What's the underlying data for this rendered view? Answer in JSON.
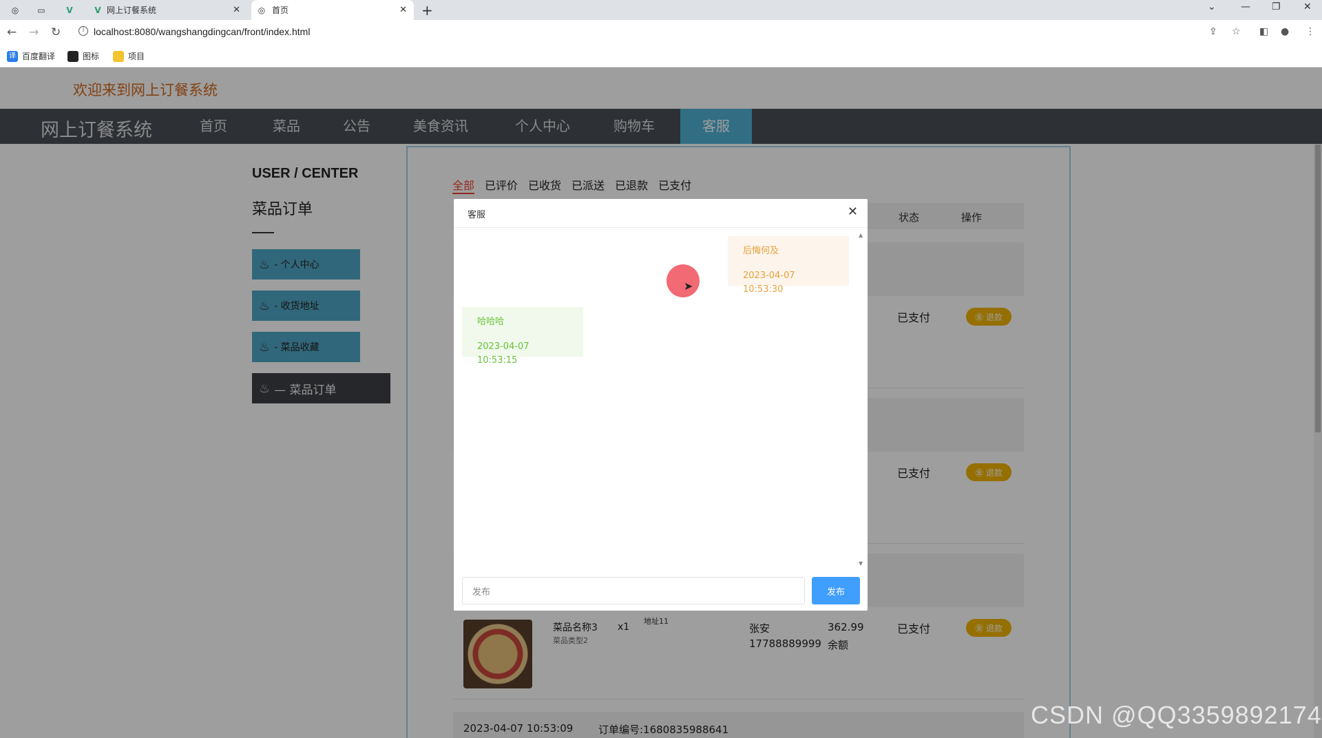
{
  "browser": {
    "tabs": [
      {
        "title": "网上订餐系统"
      },
      {
        "title": "首页"
      }
    ],
    "url": "localhost:8080/wangshangdingcan/front/index.html",
    "bookmarks": [
      "百度翻译",
      "图标",
      "项目"
    ]
  },
  "header": {
    "welcome": "欢迎来到网上订餐系统",
    "logo": "网上订餐系统",
    "nav": [
      "首页",
      "菜品",
      "公告",
      "美食资讯",
      "个人中心",
      "购物车",
      "客服"
    ],
    "active_nav": "客服"
  },
  "sidebar": {
    "heading": "USER / CENTER",
    "title": "菜品订单",
    "items": [
      {
        "label": "- 个人中心"
      },
      {
        "label": "- 收货地址"
      },
      {
        "label": "- 菜品收藏"
      },
      {
        "label": "— 菜品订单"
      }
    ]
  },
  "orders": {
    "tabs": [
      "全部",
      "已评价",
      "已收货",
      "已派送",
      "已退款",
      "已支付"
    ],
    "columns": {
      "status": "状态",
      "action": "操作"
    },
    "rows": [
      {
        "status": "已支付",
        "action": "退款"
      },
      {
        "status": "已支付",
        "action": "退款"
      },
      {
        "dish_name": "菜品名称3",
        "dish_type": "菜品类型2",
        "qty": "x1",
        "address": "地址11",
        "receiver": "张安",
        "phone": "17788889999",
        "price": "362.99",
        "pay_method": "余额",
        "status": "已支付",
        "action": "退款"
      }
    ],
    "footer": {
      "time": "2023-04-07 10:53:09",
      "order_no": "订单编号:1680835988641"
    }
  },
  "modal": {
    "title": "客服",
    "messages": [
      {
        "side": "right",
        "text": "后悔何及",
        "time": "2023-04-07 10:53:30"
      },
      {
        "side": "left",
        "text": "哈哈哈",
        "time": "2023-04-07 10:53:15"
      }
    ],
    "input_placeholder": "发布",
    "send_label": "发布"
  },
  "watermark": "CSDN @QQ3359892174",
  "colors": {
    "nav_bg": "#4a4f57",
    "nav_active": "#4fb2d6",
    "welcome": "#d2691e",
    "sidebar_btn": "#4fa6c6",
    "refund_btn": "#f0b400",
    "send_btn": "#409eff",
    "msg_right": "#e6a23c",
    "msg_left": "#67c23a"
  }
}
